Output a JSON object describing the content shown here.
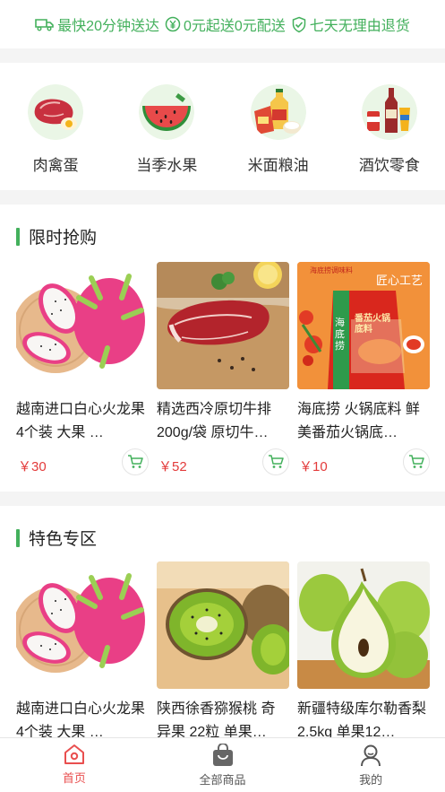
{
  "promises": [
    {
      "icon": "truck-icon",
      "label": "最快20分钟送达"
    },
    {
      "icon": "yen-coin-icon",
      "label": "0元起送0元配送"
    },
    {
      "icon": "shield-check-icon",
      "label": "七天无理由退货"
    }
  ],
  "categories": [
    {
      "icon": "meat-egg-icon",
      "label": "肉禽蛋"
    },
    {
      "icon": "watermelon-icon",
      "label": "当季水果"
    },
    {
      "icon": "grain-oil-icon",
      "label": "米面粮油"
    },
    {
      "icon": "drinks-snacks-icon",
      "label": "酒饮零食"
    }
  ],
  "flash_sale": {
    "title": "限时抢购",
    "products": [
      {
        "image": "dragon-fruit",
        "name": "越南进口白心火龙果 4个装 大果 …",
        "price": "￥30"
      },
      {
        "image": "beef-steak",
        "name": "精选西冷原切牛排200g/袋 原切牛…",
        "price": "￥52"
      },
      {
        "image": "hotpot-base",
        "name": "海底捞 火锅底料 鲜美番茄火锅底…",
        "price": "￥10",
        "package_brand": "海底捞调味料",
        "package_tag": "匠心工艺",
        "package_brand_vertical": "海底捞",
        "package_product": "番茄火锅底料"
      }
    ]
  },
  "featured": {
    "title": "特色专区",
    "products": [
      {
        "image": "dragon-fruit",
        "name": "越南进口白心火龙果 4个装 大果 …"
      },
      {
        "image": "kiwi",
        "name": "陕西徐香猕猴桃 奇异果 22粒 单果…"
      },
      {
        "image": "pear",
        "name": "新疆特级库尔勒香梨 2.5kg 单果12…"
      }
    ]
  },
  "tabbar": [
    {
      "icon": "home-icon",
      "label": "首页",
      "active": true
    },
    {
      "icon": "bag-icon",
      "label": "全部商品",
      "active": false
    },
    {
      "icon": "user-icon",
      "label": "我的",
      "active": false
    }
  ],
  "colors": {
    "accent_green": "#43b05c",
    "price_red": "#e33b3b",
    "active_tab": "#e94f4f"
  }
}
